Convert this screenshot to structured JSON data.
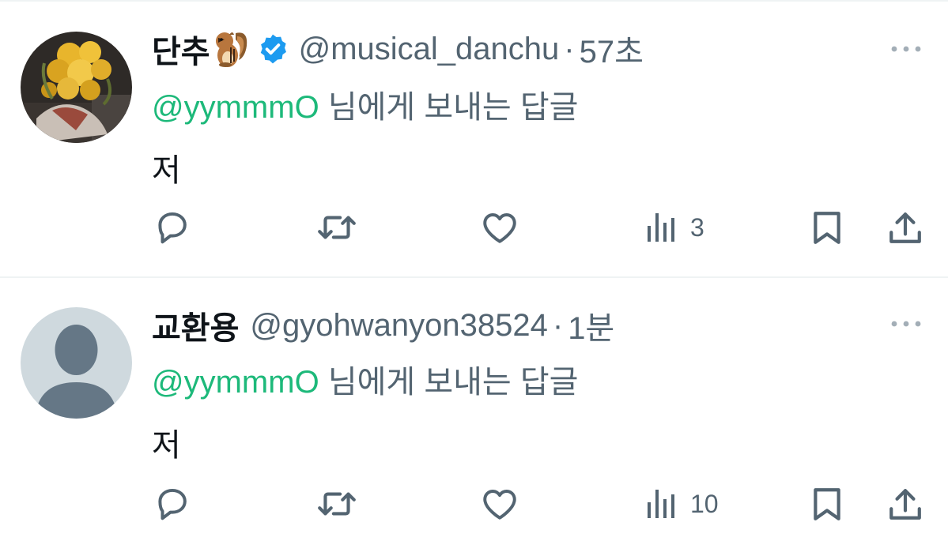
{
  "tweets": [
    {
      "display_name": "단추",
      "name_emoji": "chipmunk-emoji",
      "verified": true,
      "handle": "@musical_danchu",
      "separator": "·",
      "time": "57초",
      "reply_mention": "@yymmmO",
      "reply_suffix": "님에게 보내는 답글",
      "text": "저",
      "avatar": "yellow-roses-bouquet-photo",
      "views": "3"
    },
    {
      "display_name": "교환용",
      "name_emoji": "",
      "verified": false,
      "handle": "@gyohwanyon38524",
      "separator": "·",
      "time": "1분",
      "reply_mention": "@yymmmO",
      "reply_suffix": "님에게 보내는 답글",
      "text": "저",
      "avatar": "default-profile-silhouette",
      "views": "10"
    }
  ],
  "icons": {
    "more": "more-horizontal-icon",
    "reply": "reply-bubble-icon",
    "retweet": "retweet-icon",
    "like": "heart-icon",
    "views": "views-bar-chart-icon",
    "bookmark": "bookmark-icon",
    "share": "share-upload-icon",
    "verified": "verified-badge-icon"
  },
  "colors": {
    "text": "#0f1419",
    "secondary": "#536471",
    "mention": "#1db97a",
    "verified": "#1d9bf0",
    "divider": "#eff3f4"
  }
}
